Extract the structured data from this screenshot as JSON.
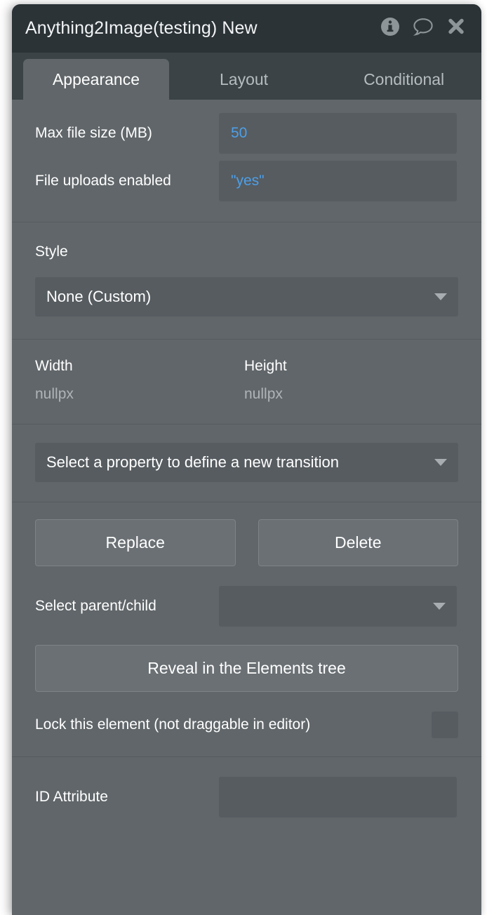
{
  "window": {
    "title": "Anything2Image(testing) New",
    "actions": [
      {
        "name": "info-icon",
        "label": "Info"
      },
      {
        "name": "comment-icon",
        "label": "Comment"
      },
      {
        "name": "close-icon",
        "label": "Close"
      }
    ]
  },
  "tabs": [
    {
      "label": "Appearance",
      "active": true
    },
    {
      "label": "Layout",
      "active": false
    },
    {
      "label": "Conditional",
      "active": false
    }
  ],
  "fields": {
    "max_file_size_label": "Max file size (MB)",
    "max_file_size_value": "50",
    "file_uploads_label": "File uploads enabled",
    "file_uploads_value": "\"yes\""
  },
  "style": {
    "label": "Style",
    "selected": "None (Custom)"
  },
  "dimensions": {
    "width_label": "Width",
    "width_value": "nullpx",
    "height_label": "Height",
    "height_value": "nullpx"
  },
  "transition": {
    "placeholder": "Select a property to define a new transition"
  },
  "actions": {
    "replace_label": "Replace",
    "delete_label": "Delete",
    "parent_child_label": "Select parent/child",
    "parent_child_value": "",
    "reveal_label": "Reveal in the Elements tree",
    "lock_label": "Lock this element (not draggable in editor)",
    "lock_checked": false
  },
  "id_attribute": {
    "label": "ID Attribute",
    "value": "",
    "placeholder": ""
  },
  "colors": {
    "panel_bg": "#606669",
    "titlebar_bg": "#2b3337",
    "tabstrip_bg": "#3b4347",
    "input_bg": "#565c60",
    "button_bg": "#6a7074",
    "value_text": "#4e9fe8",
    "muted_text": "#aeb4b7"
  }
}
